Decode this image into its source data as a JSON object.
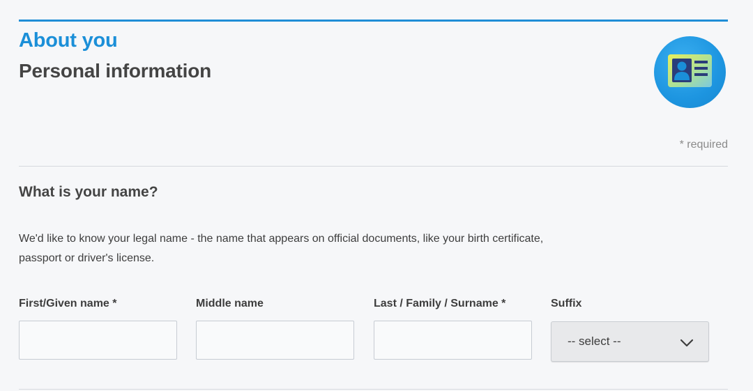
{
  "header": {
    "section": "About you",
    "title": "Personal information",
    "badge_icon": "id-card-icon",
    "accent_color": "#1b8fd8"
  },
  "required_note": "* required",
  "question": {
    "title": "What is your name?",
    "help": "We'd like to know your legal name - the name that appears on official documents, like your birth certificate, passport or driver's license."
  },
  "fields": {
    "first": {
      "label": "First/Given name *",
      "value": ""
    },
    "middle": {
      "label": "Middle name",
      "value": ""
    },
    "last": {
      "label": "Last / Family / Surname *",
      "value": ""
    },
    "suffix": {
      "label": "Suffix",
      "selected": "-- select --",
      "icon": "chevron-down-icon"
    }
  }
}
